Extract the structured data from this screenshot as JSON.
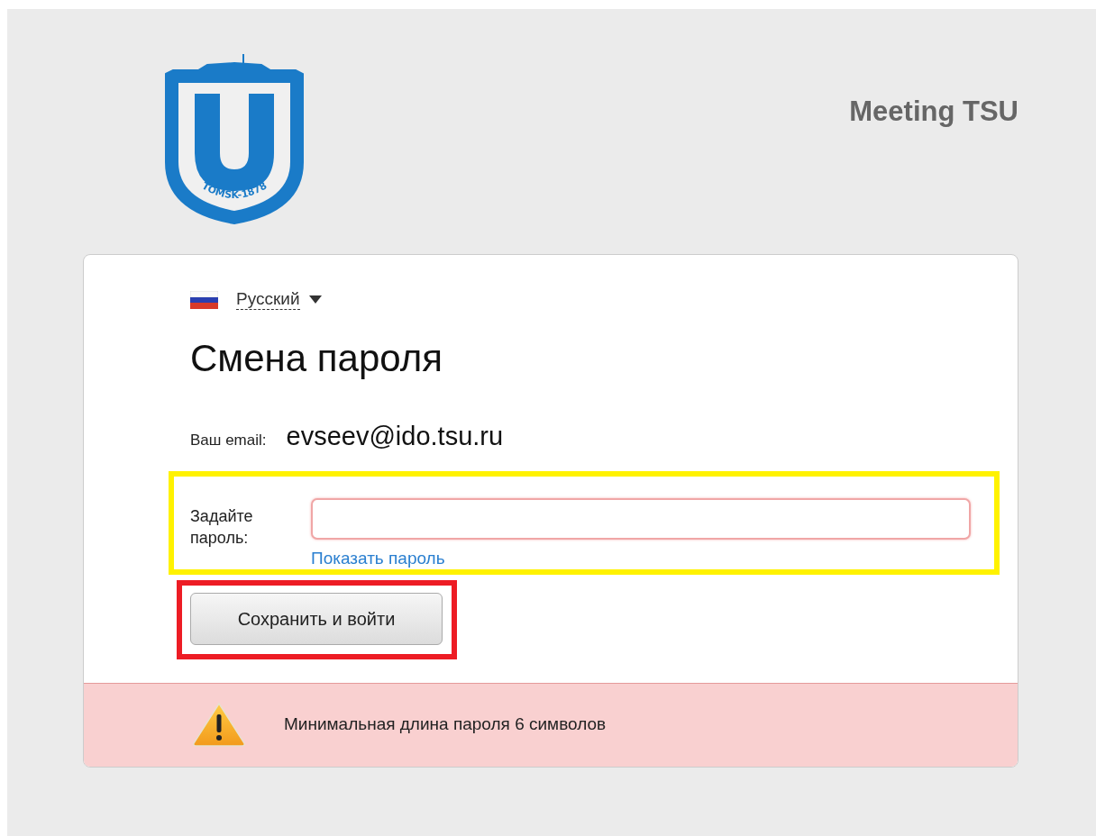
{
  "header": {
    "logo_text": "TOMSK-1878",
    "site_title": "Meeting TSU"
  },
  "language": {
    "label": "Русский"
  },
  "title": "Смена пароля",
  "email": {
    "label": "Ваш email:",
    "value": "evseev@ido.tsu.ru"
  },
  "password": {
    "label": "Задайте пароль:",
    "invalid": true,
    "show_link": "Показать пароль"
  },
  "submit": "Сохранить и войти",
  "alert": {
    "kind": "warning",
    "message": "Минимальная длина пароля 6 символов"
  }
}
